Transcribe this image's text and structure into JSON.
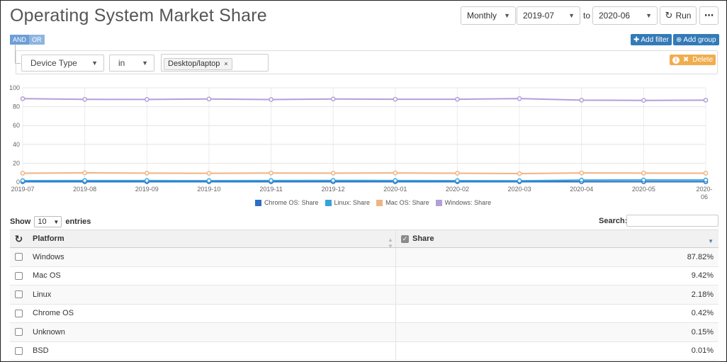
{
  "header": {
    "title": "Operating System Market Share",
    "granularity": "Monthly",
    "from": "2019-07",
    "to_label": "to",
    "to": "2020-06",
    "run_label": "Run",
    "more_label": "⋯"
  },
  "filter": {
    "and_label": "AND",
    "or_label": "OR",
    "add_filter_label": "Add filter",
    "add_group_label": "Add group",
    "field": "Device Type",
    "operator": "in",
    "value_tag": "Desktop/laptop",
    "tag_remove": "×",
    "delete_label": "Delete",
    "info_glyph": "i"
  },
  "colors": {
    "chrome_os": "#2e6ec4",
    "linux": "#36a2dd",
    "mac_os": "#f0b482",
    "windows": "#b39fd8",
    "primary": "#337ab7",
    "warning": "#f0ad4e"
  },
  "chart_data": {
    "type": "line",
    "x": [
      "2019-07",
      "2019-08",
      "2019-09",
      "2019-10",
      "2019-11",
      "2019-12",
      "2020-01",
      "2020-02",
      "2020-03",
      "2020-04",
      "2020-05",
      "2020-06"
    ],
    "x_tick_labels": [
      "2019-07",
      "2019-08",
      "2019-09",
      "2019-10",
      "2019-11",
      "2019-12",
      "2020-01",
      "2020-02",
      "2020-03",
      "2020-04",
      "2020-05",
      "2020-"
    ],
    "x_tick_last_line2": "06",
    "ylim": [
      0,
      100
    ],
    "yticks": [
      "0",
      "20",
      "40",
      "60",
      "80",
      "100"
    ],
    "grid": true,
    "legend_position": "bottom",
    "series": [
      {
        "name": "Chrome OS: Share",
        "color": "#2e6ec4",
        "values": [
          0.4,
          0.4,
          0.4,
          0.4,
          0.4,
          0.4,
          0.4,
          0.4,
          0.4,
          0.4,
          0.4,
          0.4
        ]
      },
      {
        "name": "Linux: Share",
        "color": "#36a2dd",
        "values": [
          1.5,
          1.6,
          1.6,
          1.5,
          1.6,
          1.7,
          1.6,
          1.5,
          1.4,
          2.1,
          2.2,
          2.2
        ]
      },
      {
        "name": "Mac OS: Share",
        "color": "#f0b482",
        "values": [
          9.4,
          9.8,
          9.5,
          9.3,
          9.6,
          9.5,
          9.7,
          9.4,
          9.0,
          9.7,
          9.5,
          9.4
        ]
      },
      {
        "name": "Windows: Share",
        "color": "#b39fd8",
        "values": [
          88.5,
          87.8,
          87.7,
          88.2,
          87.6,
          88.2,
          87.9,
          87.9,
          88.6,
          86.9,
          86.7,
          86.9
        ]
      }
    ]
  },
  "table": {
    "show_label": "Show",
    "entries_label": "entries",
    "page_size": "10",
    "search_label": "Search:",
    "col_platform": "Platform",
    "col_share": "Share",
    "refresh_glyph": "↻",
    "check_glyph": "✓",
    "rows": [
      {
        "platform": "Windows",
        "share": "87.82%"
      },
      {
        "platform": "Mac OS",
        "share": "9.42%"
      },
      {
        "platform": "Linux",
        "share": "2.18%"
      },
      {
        "platform": "Chrome OS",
        "share": "0.42%"
      },
      {
        "platform": "Unknown",
        "share": "0.15%"
      },
      {
        "platform": "BSD",
        "share": "0.01%"
      }
    ]
  }
}
